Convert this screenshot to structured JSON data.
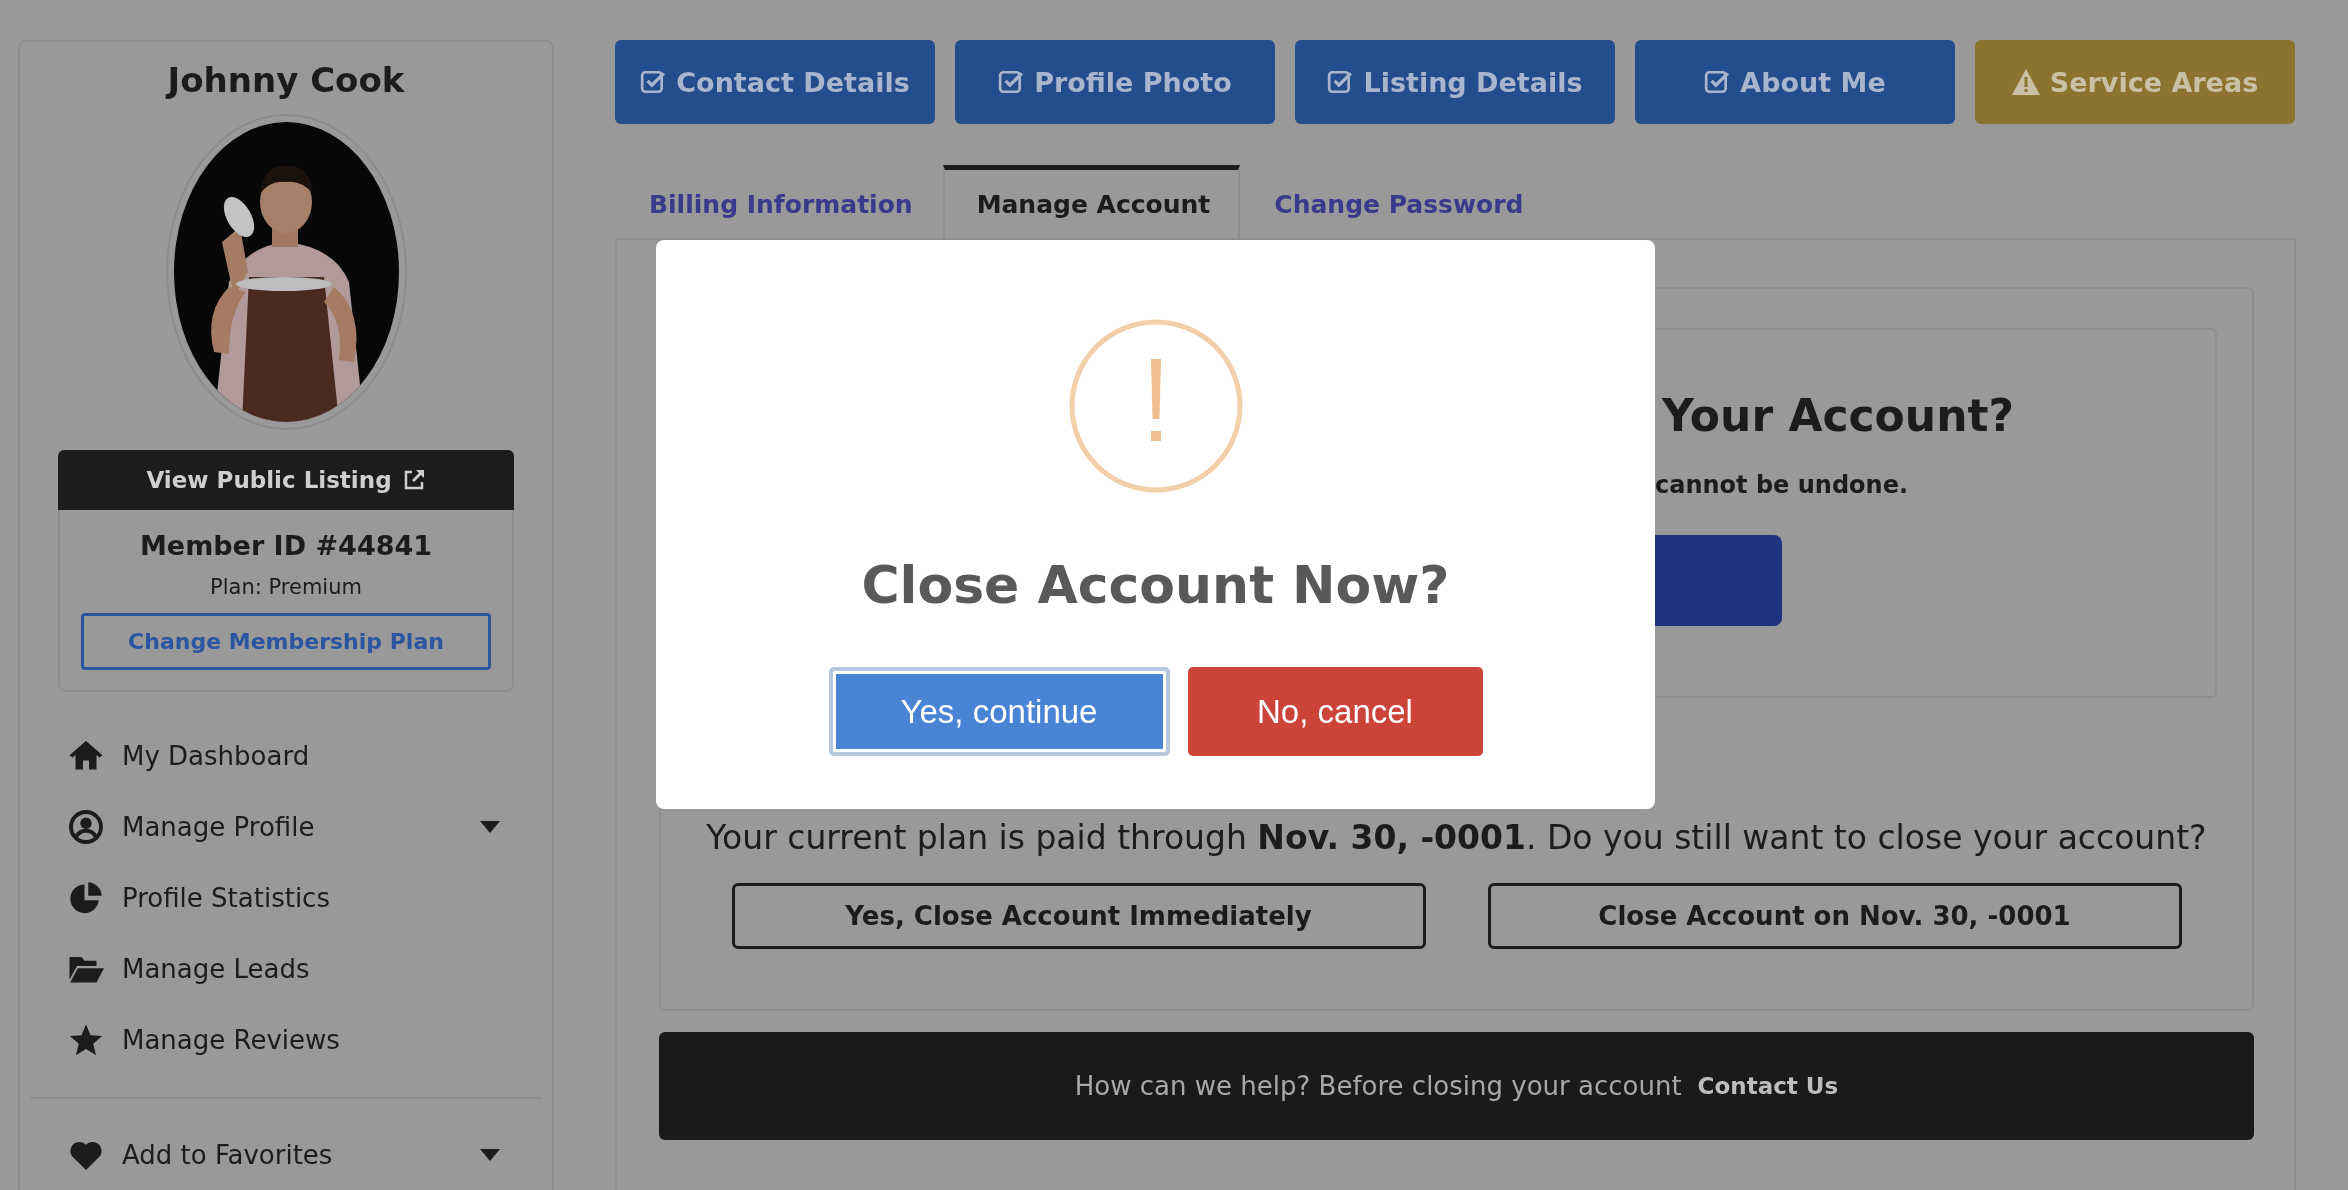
{
  "profile": {
    "name": "Johnny Cook",
    "public_listing_button": "View Public Listing",
    "member_id": "Member ID #44841",
    "plan": "Plan: Premium",
    "change_plan_button": "Change Membership Plan"
  },
  "sidebar": {
    "items": [
      {
        "label": "My Dashboard",
        "kind": "home",
        "expandable": false
      },
      {
        "label": "Manage Profile",
        "kind": "profile",
        "expandable": true
      },
      {
        "label": "Profile Statistics",
        "kind": "statistics",
        "expandable": false
      },
      {
        "label": "Manage Leads",
        "kind": "leads",
        "expandable": false
      },
      {
        "label": "Manage Reviews",
        "kind": "reviews",
        "expandable": false
      }
    ],
    "secondary_items": [
      {
        "label": "Add to Favorites",
        "kind": "favorites",
        "expandable": true
      }
    ]
  },
  "steps": [
    {
      "label": "Contact Details",
      "kind": "complete"
    },
    {
      "label": "Profile Photo",
      "kind": "complete"
    },
    {
      "label": "Listing Details",
      "kind": "complete"
    },
    {
      "label": "About Me",
      "kind": "complete"
    },
    {
      "label": "Service Areas",
      "kind": "warning"
    }
  ],
  "tabs": [
    {
      "label": "Billing Information",
      "selected": false
    },
    {
      "label": "Manage Account",
      "selected": true
    },
    {
      "label": "Change Password",
      "selected": false
    }
  ],
  "close_section": {
    "heading": "Your Account?",
    "note": "cannot be undone.",
    "plan_notice": "Your current plan is paid through **Nov. 30, -0001**. Do you still want to close your account?",
    "buttons": [
      "Yes, Close Account Immediately",
      "Close Account on Nov. 30, -0001"
    ]
  },
  "help_bar": {
    "text": "How can we help? Before closing your account",
    "link": "Contact Us"
  },
  "dialog": {
    "kind": "warning",
    "title": "Close Account Now?",
    "buttons": [
      {
        "label": "Yes, continue",
        "kind": "confirm",
        "focused": true
      },
      {
        "label": "No, cancel",
        "kind": "cancel",
        "focused": false
      }
    ]
  }
}
